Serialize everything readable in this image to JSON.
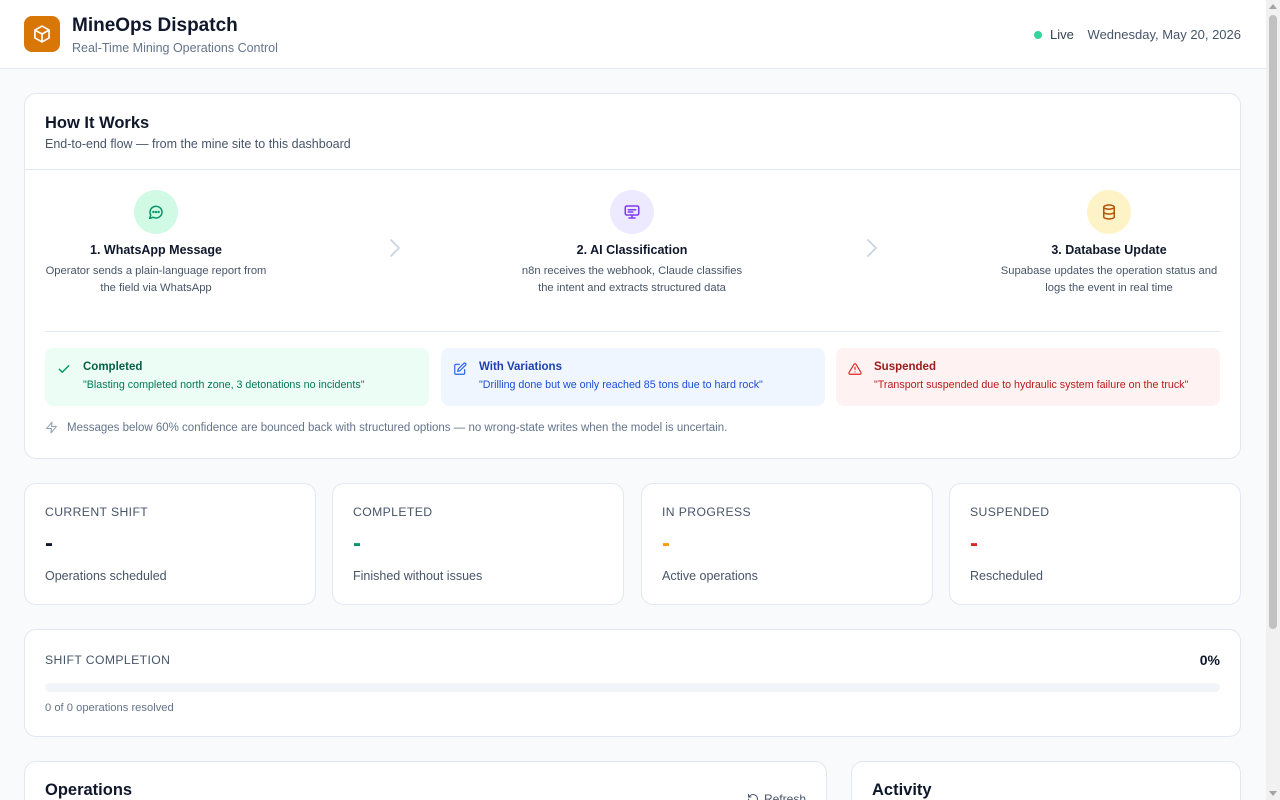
{
  "header": {
    "title": "MineOps Dispatch",
    "subtitle": "Real-Time Mining Operations Control",
    "live_label": "Live",
    "date": "Wednesday, May 20, 2026",
    "logo_icon": "cube-icon",
    "brand_color": "#d97706"
  },
  "how_it_works": {
    "title": "How It Works",
    "subtitle": "End-to-end flow — from the mine site to this dashboard",
    "steps": [
      {
        "title": "1. WhatsApp Message",
        "description": "Operator sends a plain-language report from the field via WhatsApp",
        "icon": "chat-bubble-icon",
        "color": "#059669"
      },
      {
        "title": "2. AI Classification",
        "description": "n8n receives the webhook, Claude classifies the intent and extracts structured data",
        "icon": "monitor-icon",
        "color": "#7c3aed"
      },
      {
        "title": "3. Database Update",
        "description": "Supabase updates the operation status and logs the event in real time",
        "icon": "database-icon",
        "color": "#b45309"
      }
    ],
    "examples": [
      {
        "title": "Completed",
        "quote": "\"Blasting completed north zone, 3 detonations no incidents\"",
        "icon": "check-icon"
      },
      {
        "title": "With Variations",
        "quote": "\"Drilling done but we only reached 85 tons due to hard rock\"",
        "icon": "edit-icon"
      },
      {
        "title": "Suspended",
        "quote": "\"Transport suspended due to hydraulic system failure on the truck\"",
        "icon": "warning-icon"
      }
    ],
    "note": "Messages below 60% confidence are bounced back with structured options — no wrong-state writes when the model is uncertain."
  },
  "stats": [
    {
      "label": "CURRENT SHIFT",
      "value": "-",
      "caption": "Operations scheduled",
      "color": "#0f172a"
    },
    {
      "label": "COMPLETED",
      "value": "-",
      "caption": "Finished without issues",
      "color": "#059669"
    },
    {
      "label": "IN PROGRESS",
      "value": "-",
      "caption": "Active operations",
      "color": "#f59e0b"
    },
    {
      "label": "SUSPENDED",
      "value": "-",
      "caption": "Rescheduled",
      "color": "#dc2626"
    }
  ],
  "shift_completion": {
    "label": "SHIFT COMPLETION",
    "value_text": "0%",
    "progress": 0,
    "caption": "0 of 0 operations resolved"
  },
  "operations": {
    "title": "Operations",
    "refresh_label": "Refresh"
  },
  "activity": {
    "title": "Activity"
  }
}
